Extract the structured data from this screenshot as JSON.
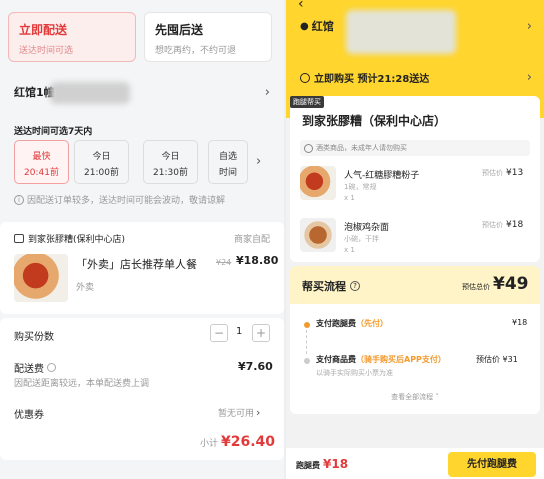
{
  "left": {
    "tabs": [
      {
        "title": "立即配送",
        "sub": "送达时间可选"
      },
      {
        "title": "先囤后送",
        "sub": "想吃再约，不约可退"
      }
    ],
    "address": "红馆1幢",
    "delivery_range_label": "送达时间可选7天内",
    "slots": [
      {
        "line1": "最快",
        "line2": "20:41前"
      },
      {
        "line1": "今日",
        "line2": "21:00前"
      },
      {
        "line1": "今日",
        "line2": "21:30前"
      },
      {
        "line1": "自选",
        "line2": "时间"
      }
    ],
    "notice": "因配送订单较多，送达时间可能会波动，敬请谅解",
    "store": {
      "name": "到家张膠糟(保利中心店)",
      "pickup": "商家自配"
    },
    "product": {
      "name": "「外卖」店长推荐单人餐",
      "orig_price": "¥24",
      "price": "¥18.80",
      "tag": "外卖"
    },
    "qty_label": "购买份数",
    "qty_minus": "−",
    "qty_value": "1",
    "qty_plus": "+",
    "fee_label": "配送费",
    "fee_note": "因配送距离较远，本单配送费上调",
    "fee_value": "¥7.60",
    "coupon_label": "优惠券",
    "coupon_value": "暂无可用",
    "subtotal_label": "小计",
    "subtotal_value": "¥26.40"
  },
  "right": {
    "back": "‹",
    "address": "红馆",
    "time_label": "立即购买 预计21:28送达",
    "badge": "跑腿帮买",
    "store_name": "到家张膠糟（保利中心店）",
    "warning": "酒类商品，未成年人请勿购买",
    "items": [
      {
        "name": "人气-红糖膠糟粉子",
        "spec": "1碗，常规",
        "qty": "x 1",
        "est": "预估价",
        "price": "¥13"
      },
      {
        "name": "泡椒鸡杂面",
        "spec": "小碗，干拌",
        "qty": "x 1",
        "est": "预估价",
        "price": "¥18"
      }
    ],
    "process_title": "帮买流程",
    "process_help": "?",
    "total_label": "预估总价",
    "total_value": "¥49",
    "steps": [
      {
        "label": "支付跑腿费",
        "highlight": "（先付）",
        "price": "¥18"
      },
      {
        "label": "支付商品费",
        "highlight": "（骑手购买后APP支付）",
        "price": "预估价 ¥31"
      }
    ],
    "step_note": "以骑手实际购买小票为准",
    "view_all": "查看全部流程 ˅",
    "fee_label": "跑腿费",
    "fee_value": "¥18",
    "pay_button": "先付跑腿费"
  }
}
